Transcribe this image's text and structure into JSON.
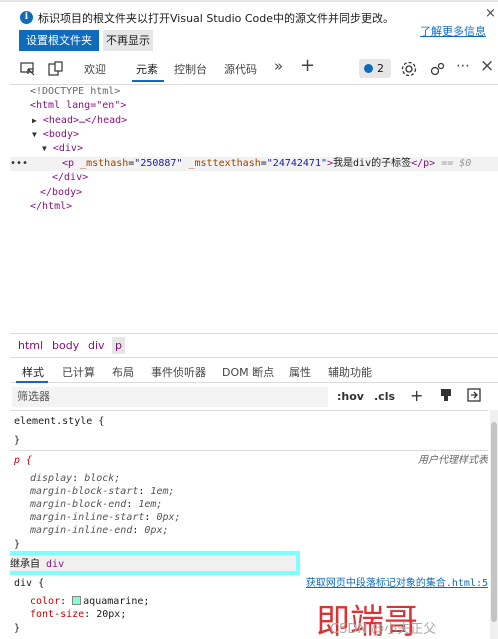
{
  "banner": {
    "message": "标识项目的根文件夹以打开Visual Studio Code中的源文件并同步更改。",
    "learn_more": "了解更多信息",
    "close": "×",
    "primary_button": "设置根文件夹",
    "secondary_button": "不再显示"
  },
  "toolbar": {
    "tabs": [
      "欢迎",
      "元素",
      "控制台",
      "源代码"
    ],
    "active_tab": "元素",
    "more": "»",
    "add": "+",
    "issues_count": "2",
    "menu": "⋯",
    "close": "×"
  },
  "dom": {
    "doctype": "<!DOCTYPE html>",
    "html_open": "<html lang=\"en\">",
    "head": "<head>…</head>",
    "body_open": "<body>",
    "div_open": "<div>",
    "p_tag": "p",
    "p_attr1_name": "_msthash",
    "p_attr1_value": "\"250887\"",
    "p_attr2_name": "_msttexthash",
    "p_attr2_value": "\"24742471\"",
    "p_text": "我是div的子标签",
    "p_close": "</p>",
    "selected_marker": "== $0",
    "div_close": "</div>",
    "body_close": "</body>",
    "html_close": "</html>",
    "ellipsis": "•••"
  },
  "breadcrumb": [
    "html",
    "body",
    "div",
    "p"
  ],
  "styles_tabs": [
    "样式",
    "已计算",
    "布局",
    "事件侦听器",
    "DOM 断点",
    "属性",
    "辅助功能"
  ],
  "filter": {
    "placeholder": "筛选器",
    "hov": ":hov",
    "cls": ".cls"
  },
  "styles": {
    "element_style": "element.style {",
    "close_brace": "}",
    "ua_selector": "p {",
    "ua_origin": "用户代理样式表",
    "ua_props": [
      {
        "name": "display",
        "value": "block;"
      },
      {
        "name": "margin-block-start",
        "value": "1em;"
      },
      {
        "name": "margin-block-end",
        "value": "1em;"
      },
      {
        "name": "margin-inline-start",
        "value": "0px;"
      },
      {
        "name": "margin-inline-end",
        "value": "0px;"
      }
    ],
    "inherited_label": "继承自",
    "inherited_from": "div",
    "div_selector": "div {",
    "div_source": "获取网页中段落标记对象的集合.html:5",
    "div_props": [
      {
        "name": "color",
        "value": "aquamarine;"
      },
      {
        "name": "font-size",
        "value": "20px;"
      }
    ],
    "swatch_color": "#7fffd4"
  },
  "watermark": {
    "big": "即端哥",
    "small": "CSDN @小夫正父"
  }
}
